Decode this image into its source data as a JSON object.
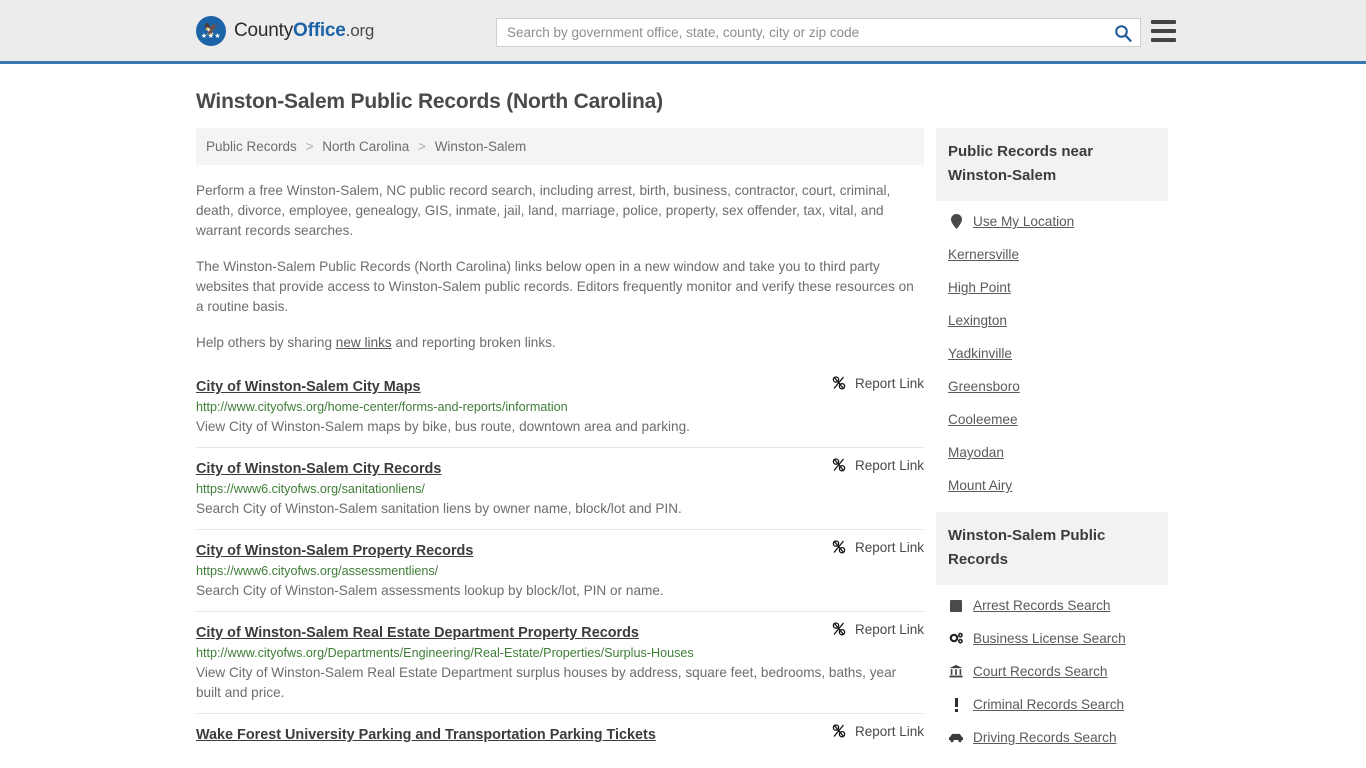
{
  "header": {
    "brand_pre": "County",
    "brand_bold": "Office",
    "brand_suffix": ".org",
    "search_placeholder": "Search by government office, state, county, city or zip code",
    "search_value": "",
    "search_icon": "search-icon",
    "menu_icon": "hamburger-menu-icon",
    "accent_color": "#3b77ad",
    "background_color": "#ececec"
  },
  "page": {
    "title": "Winston-Salem Public Records (North Carolina)"
  },
  "breadcrumb": {
    "separator": ">",
    "items": [
      {
        "label": "Public Records"
      },
      {
        "label": "North Carolina"
      },
      {
        "label": "Winston-Salem"
      }
    ]
  },
  "intro": {
    "paragraph1": "Perform a free Winston-Salem, NC public record search, including arrest, birth, business, contractor, court, criminal, death, divorce, employee, genealogy, GIS, inmate, jail, land, marriage, police, property, sex offender, tax, vital, and warrant records searches.",
    "paragraph2": "The Winston-Salem Public Records (North Carolina) links below open in a new window and take you to third party websites that provide access to Winston-Salem public records. Editors frequently monitor and verify these resources on a routine basis.",
    "help_prefix": "Help others by sharing ",
    "help_link": "new links",
    "help_suffix": " and reporting broken links."
  },
  "results": {
    "report_label": "Report Link",
    "report_icon": "broken-link-icon",
    "url_color": "#3f7d37",
    "items": [
      {
        "title": "City of Winston-Salem City Maps",
        "url": "http://www.cityofws.org/home-center/forms-and-reports/information",
        "description": "View City of Winston-Salem maps by bike, bus route, downtown area and parking."
      },
      {
        "title": "City of Winston-Salem City Records",
        "url": "https://www6.cityofws.org/sanitationliens/",
        "description": "Search City of Winston-Salem sanitation liens by owner name, block/lot and PIN."
      },
      {
        "title": "City of Winston-Salem Property Records",
        "url": "https://www6.cityofws.org/assessmentliens/",
        "description": "Search City of Winston-Salem assessments lookup by block/lot, PIN or name."
      },
      {
        "title": "City of Winston-Salem Real Estate Department Property Records",
        "url": "http://www.cityofws.org/Departments/Engineering/Real-Estate/Properties/Surplus-Houses",
        "description": "View City of Winston-Salem Real Estate Department surplus houses by address, square feet, bedrooms, baths, year built and price."
      },
      {
        "title": "Wake Forest University Parking and Transportation Parking Tickets",
        "url": "",
        "description": ""
      }
    ]
  },
  "sidebar": {
    "nearby": {
      "heading": "Public Records near Winston-Salem",
      "items": [
        {
          "label": "Use My Location",
          "icon": "map-pin-icon"
        },
        {
          "label": "Kernersville",
          "icon": ""
        },
        {
          "label": "High Point",
          "icon": ""
        },
        {
          "label": "Lexington",
          "icon": ""
        },
        {
          "label": "Yadkinville",
          "icon": ""
        },
        {
          "label": "Greensboro",
          "icon": ""
        },
        {
          "label": "Cooleemee",
          "icon": ""
        },
        {
          "label": "Mayodan",
          "icon": ""
        },
        {
          "label": "Mount Airy",
          "icon": ""
        }
      ]
    },
    "records": {
      "heading": "Winston-Salem Public Records",
      "items": [
        {
          "label": "Arrest Records Search",
          "icon": "fingerprint-icon"
        },
        {
          "label": "Business License Search",
          "icon": "gears-icon"
        },
        {
          "label": "Court Records Search",
          "icon": "courthouse-icon"
        },
        {
          "label": "Criminal Records Search",
          "icon": "exclamation-icon"
        },
        {
          "label": "Driving Records Search",
          "icon": "car-icon"
        }
      ]
    }
  }
}
